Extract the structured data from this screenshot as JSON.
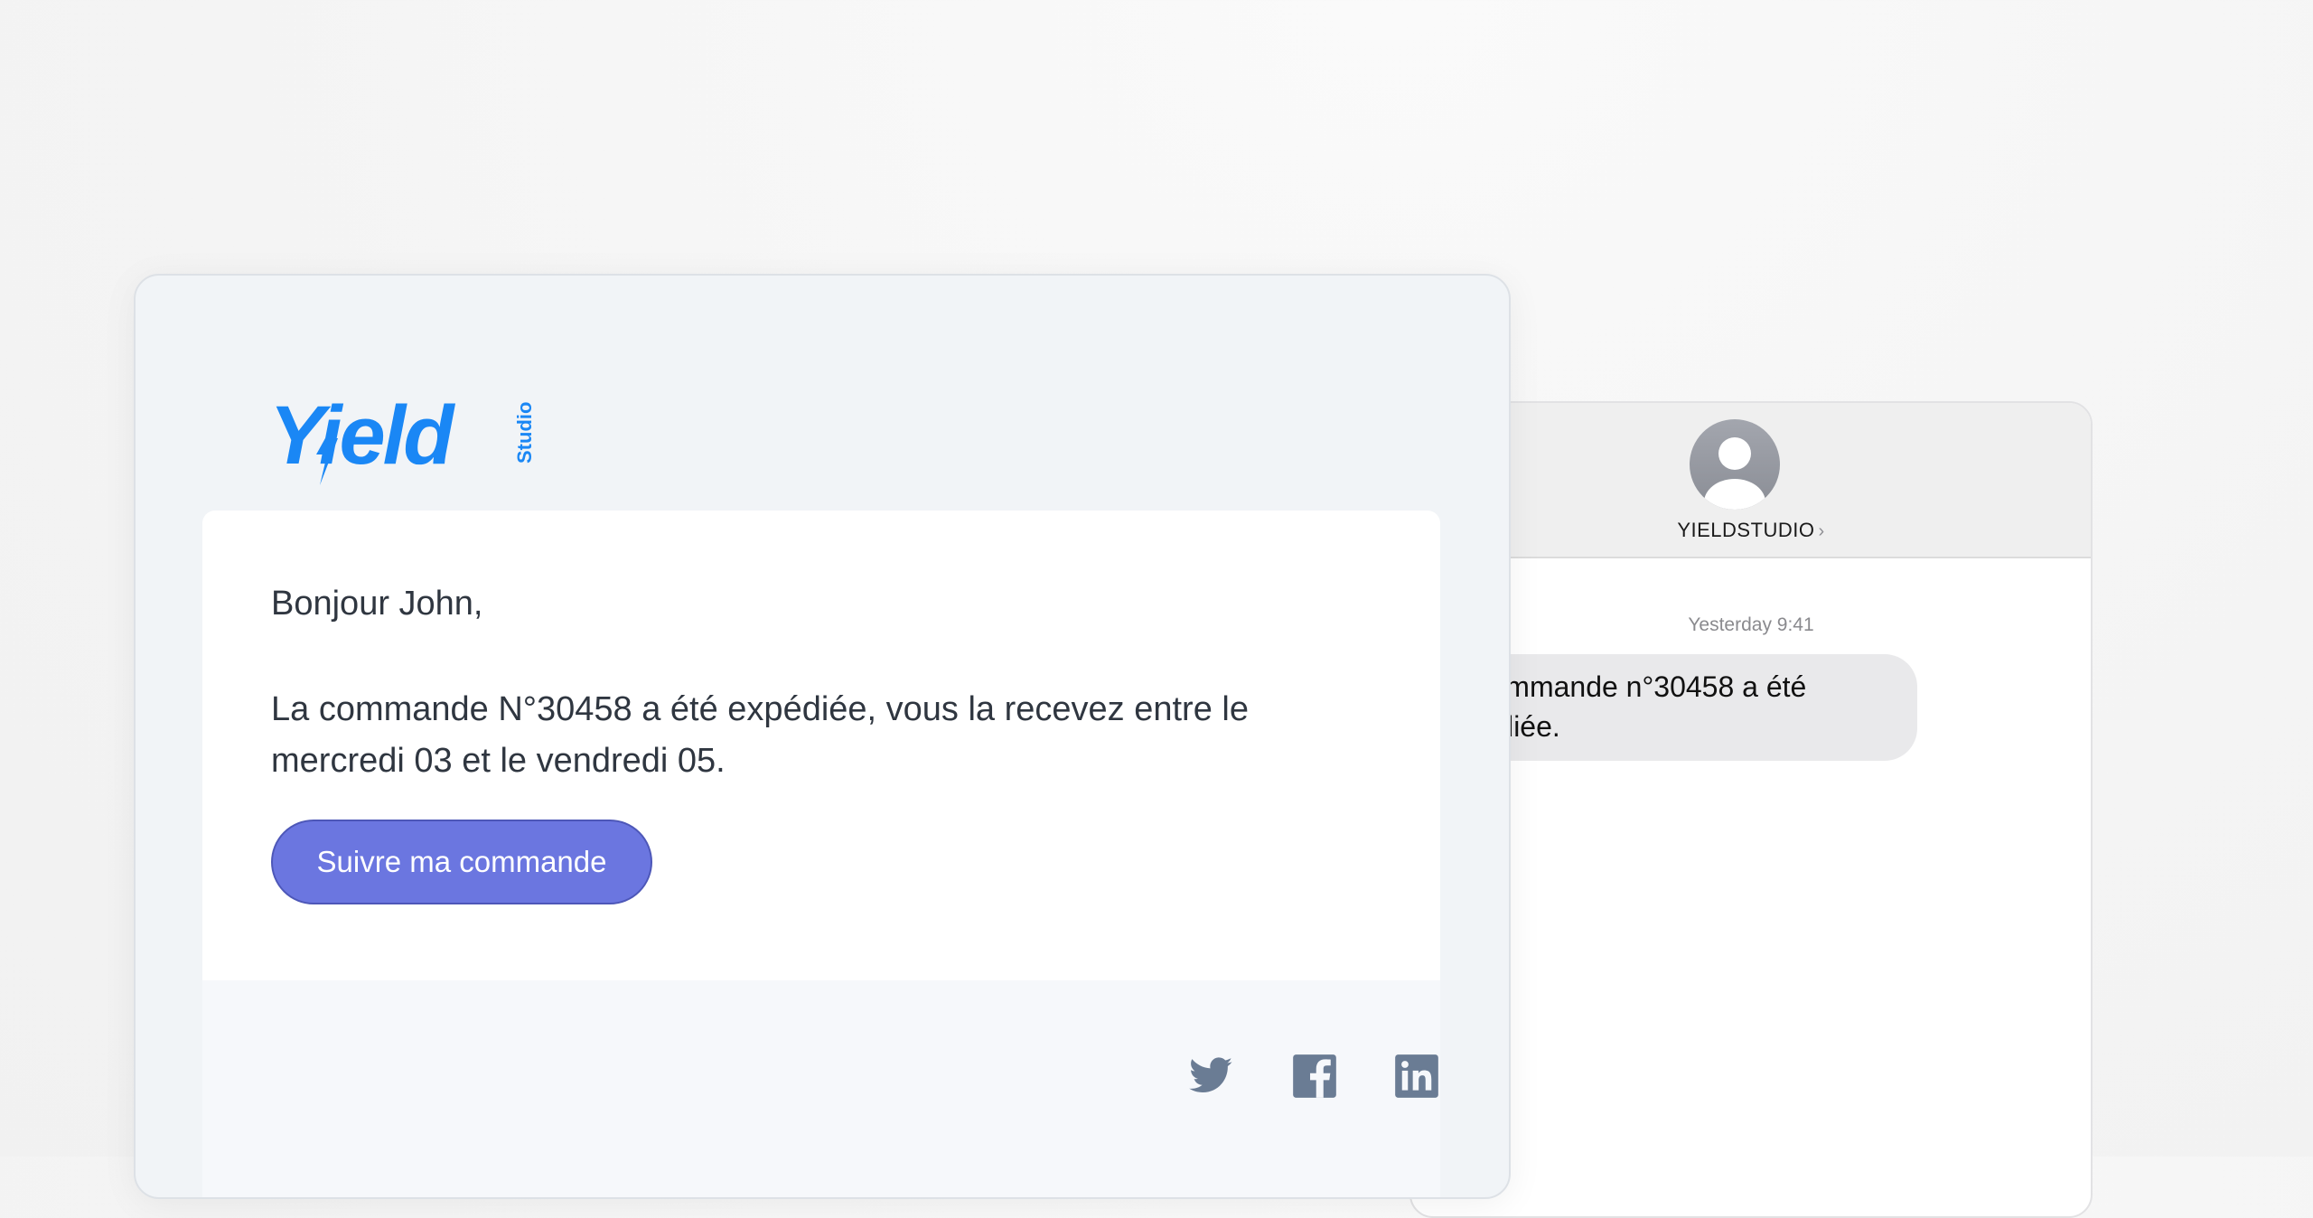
{
  "email": {
    "logo": {
      "word": "Yield",
      "sub": "Studio",
      "color": "#1a87f5"
    },
    "greeting": "Bonjour John,",
    "message": "La commande N°30458 a été expédiée, vous la recevez entre le mercredi 03 et le vendredi 05.",
    "cta_label": "Suivre ma commande",
    "social": [
      {
        "name": "twitter-icon"
      },
      {
        "name": "facebook-icon"
      },
      {
        "name": "linkedin-icon"
      }
    ]
  },
  "sms": {
    "contact": "YIELDSTUDIO",
    "chevron": "›",
    "timestamp": "Yesterday 9:41",
    "message": "La commande n°30458 a été expédiée."
  }
}
